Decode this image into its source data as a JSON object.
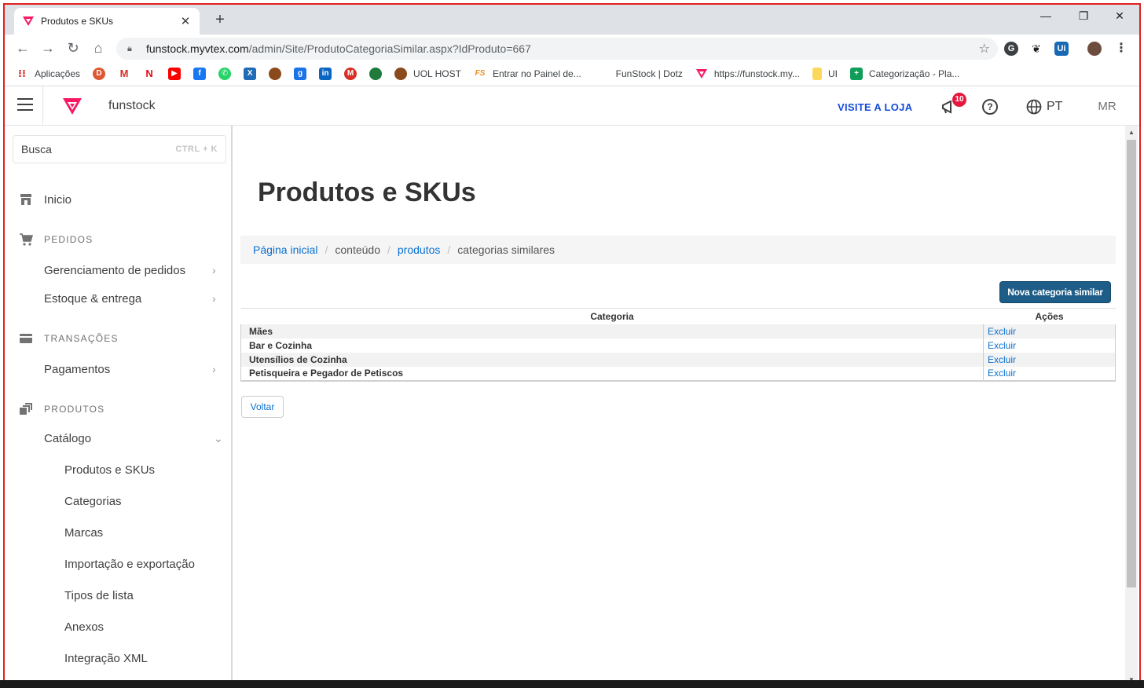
{
  "browser": {
    "tab_title": "Produtos e SKUs",
    "url_host": "funstock.myvtex.com",
    "url_path": "/admin/Site/ProdutoCategoriaSimilar.aspx?IdProduto=667"
  },
  "bookmarks": {
    "apps": "Aplicações",
    "uol": "UOL HOST",
    "fs": "Entrar no Painel de...",
    "dotz": "FunStock | Dotz",
    "funstock": "https://funstock.my...",
    "ui": "UI",
    "categ": "Categorização - Pla..."
  },
  "vtex": {
    "store_name": "funstock",
    "visit_store": "VISITE A LOJA",
    "notif_count": "10",
    "help": "?",
    "lang": "PT",
    "user_initials": "MR"
  },
  "sidebar": {
    "search_placeholder": "Busca",
    "search_shortcut": "CTRL + K",
    "inicio": "Inicio",
    "pedidos_section": "PEDIDOS",
    "gerenciamento": "Gerenciamento de pedidos",
    "estoque": "Estoque & entrega",
    "transacoes_section": "TRANSAÇÕES",
    "pagamentos": "Pagamentos",
    "produtos_section": "PRODUTOS",
    "catalogo": "Catálogo",
    "catalog_items": [
      "Produtos e SKUs",
      "Categorias",
      "Marcas",
      "Importação e exportação",
      "Tipos de lista",
      "Anexos",
      "Integração XML"
    ]
  },
  "main": {
    "title": "Produtos e SKUs",
    "breadcrumb": {
      "home": "Página inicial",
      "content": "conteúdo",
      "products": "produtos",
      "current": "categorias similares"
    },
    "new_button": "Nova categoria similar",
    "table": {
      "col_category": "Categoria",
      "col_actions": "Ações",
      "rows": [
        {
          "category": "Mães",
          "action": "Excluir"
        },
        {
          "category": "Bar e Cozinha",
          "action": "Excluir"
        },
        {
          "category": "Utensílios de Cozinha",
          "action": "Excluir"
        },
        {
          "category": "Petisqueira e Pegador de Petiscos",
          "action": "Excluir"
        }
      ]
    },
    "back_button": "Voltar"
  },
  "colors": {
    "vtex_pink": "#f71963",
    "link_blue": "#0a70cf",
    "primary_button": "#1e5d87",
    "visit_blue": "#134cd8",
    "badge_red": "#e5173f"
  }
}
